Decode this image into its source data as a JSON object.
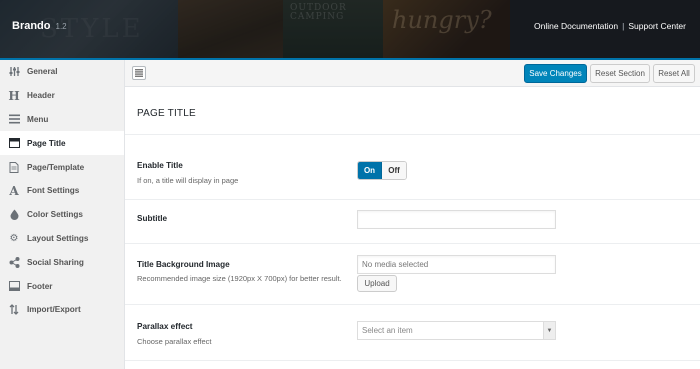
{
  "header": {
    "brand": "Brando",
    "version": "1.2",
    "hero_texts": {
      "camping": "OUTDOOR CAMPING",
      "hungry": "hungry?",
      "style": "STYLE"
    },
    "links": [
      "Online Documentation",
      "Support Center"
    ],
    "accent_color": "#0073aa"
  },
  "sidebar": {
    "items": [
      {
        "label": "General",
        "icon": "sliders-icon"
      },
      {
        "label": "Header",
        "icon": "heading-icon"
      },
      {
        "label": "Menu",
        "icon": "menu-icon"
      },
      {
        "label": "Page Title",
        "icon": "page-title-icon",
        "active": true
      },
      {
        "label": "Page/Template",
        "icon": "page-icon"
      },
      {
        "label": "Font Settings",
        "icon": "font-icon"
      },
      {
        "label": "Color Settings",
        "icon": "droplet-icon"
      },
      {
        "label": "Layout Settings",
        "icon": "gears-icon"
      },
      {
        "label": "Social Sharing",
        "icon": "share-icon"
      },
      {
        "label": "Footer",
        "icon": "footer-icon"
      },
      {
        "label": "Import/Export",
        "icon": "import-export-icon"
      }
    ]
  },
  "toolbar": {
    "save_label": "Save Changes",
    "reset_section_label": "Reset Section",
    "reset_all_label": "Reset All",
    "primary_color": "#0085ba"
  },
  "main": {
    "section_title": "PAGE TITLE",
    "enable_title": {
      "label": "Enable Title",
      "description": "If on, a title will display in page",
      "on_label": "On",
      "off_label": "Off",
      "value": "On"
    },
    "subtitle": {
      "label": "Subtitle",
      "value": ""
    },
    "title_bg": {
      "label": "Title Background Image",
      "description": "Recommended image size (1920px X 700px) for better result.",
      "placeholder": "No media selected",
      "upload_label": "Upload"
    },
    "parallax": {
      "label": "Parallax effect",
      "description": "Choose parallax effect",
      "placeholder": "Select an item"
    }
  }
}
